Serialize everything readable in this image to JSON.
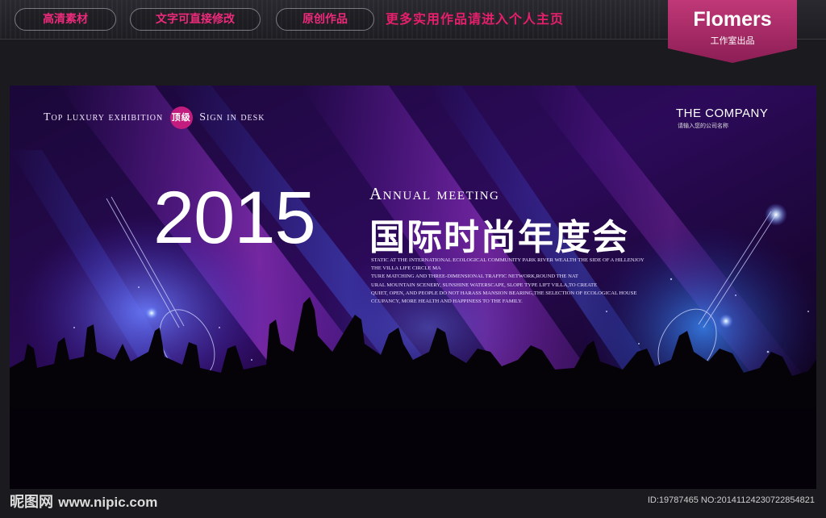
{
  "topbar": {
    "buttons": [
      "高清素材",
      "文字可直接修改",
      "原创作品"
    ],
    "promo": "更多实用作品请进入个人主页"
  },
  "brand": {
    "name": "Flomers",
    "sub": "工作室出品"
  },
  "poster": {
    "tagline_left": "Top luxury exhibition",
    "badge": "顶级",
    "tagline_right": "Sign in desk",
    "company": "THE COMPANY",
    "company_sub": "请输入您的公司名称",
    "year": "2015",
    "annual": "Annual meeting",
    "title_cn": "国际时尚年度会",
    "body_lines": [
      "STATIC AT THE INTERNATIONAL ECOLOGICAL COMMUNITY PARK RIVER WEALTH THE SIDE OF A HILLENJOY",
      "THE VILLA LIFE CIRCLE MA",
      "TURE MATCHING AND THREE-DIMENSIONAL TRAFFIC NETWORK,ROUND THE NAT",
      "URAL MOUNTAIN SCENERY, SUNSHINE WATERSCAPE, SLOPE TYPE LIFT VILLA,TO CREATE",
      "QUIET, OPEN, AND PEOPLE DO NOT HARASS MANSION BEARING,THE SELECTION OF ECOLOGICAL HOUSE",
      "CCUPANCY, MORE HEALTH AND HAPPINESS TO THE FAMILY."
    ]
  },
  "footer": {
    "logo": "昵图网",
    "url": "www.nipic.com",
    "id": "ID:19787465 NO:20141124230722854821"
  },
  "colors": {
    "accent": "#e51f6c",
    "purple": "#9b2df0",
    "blue": "#3a4cff"
  }
}
